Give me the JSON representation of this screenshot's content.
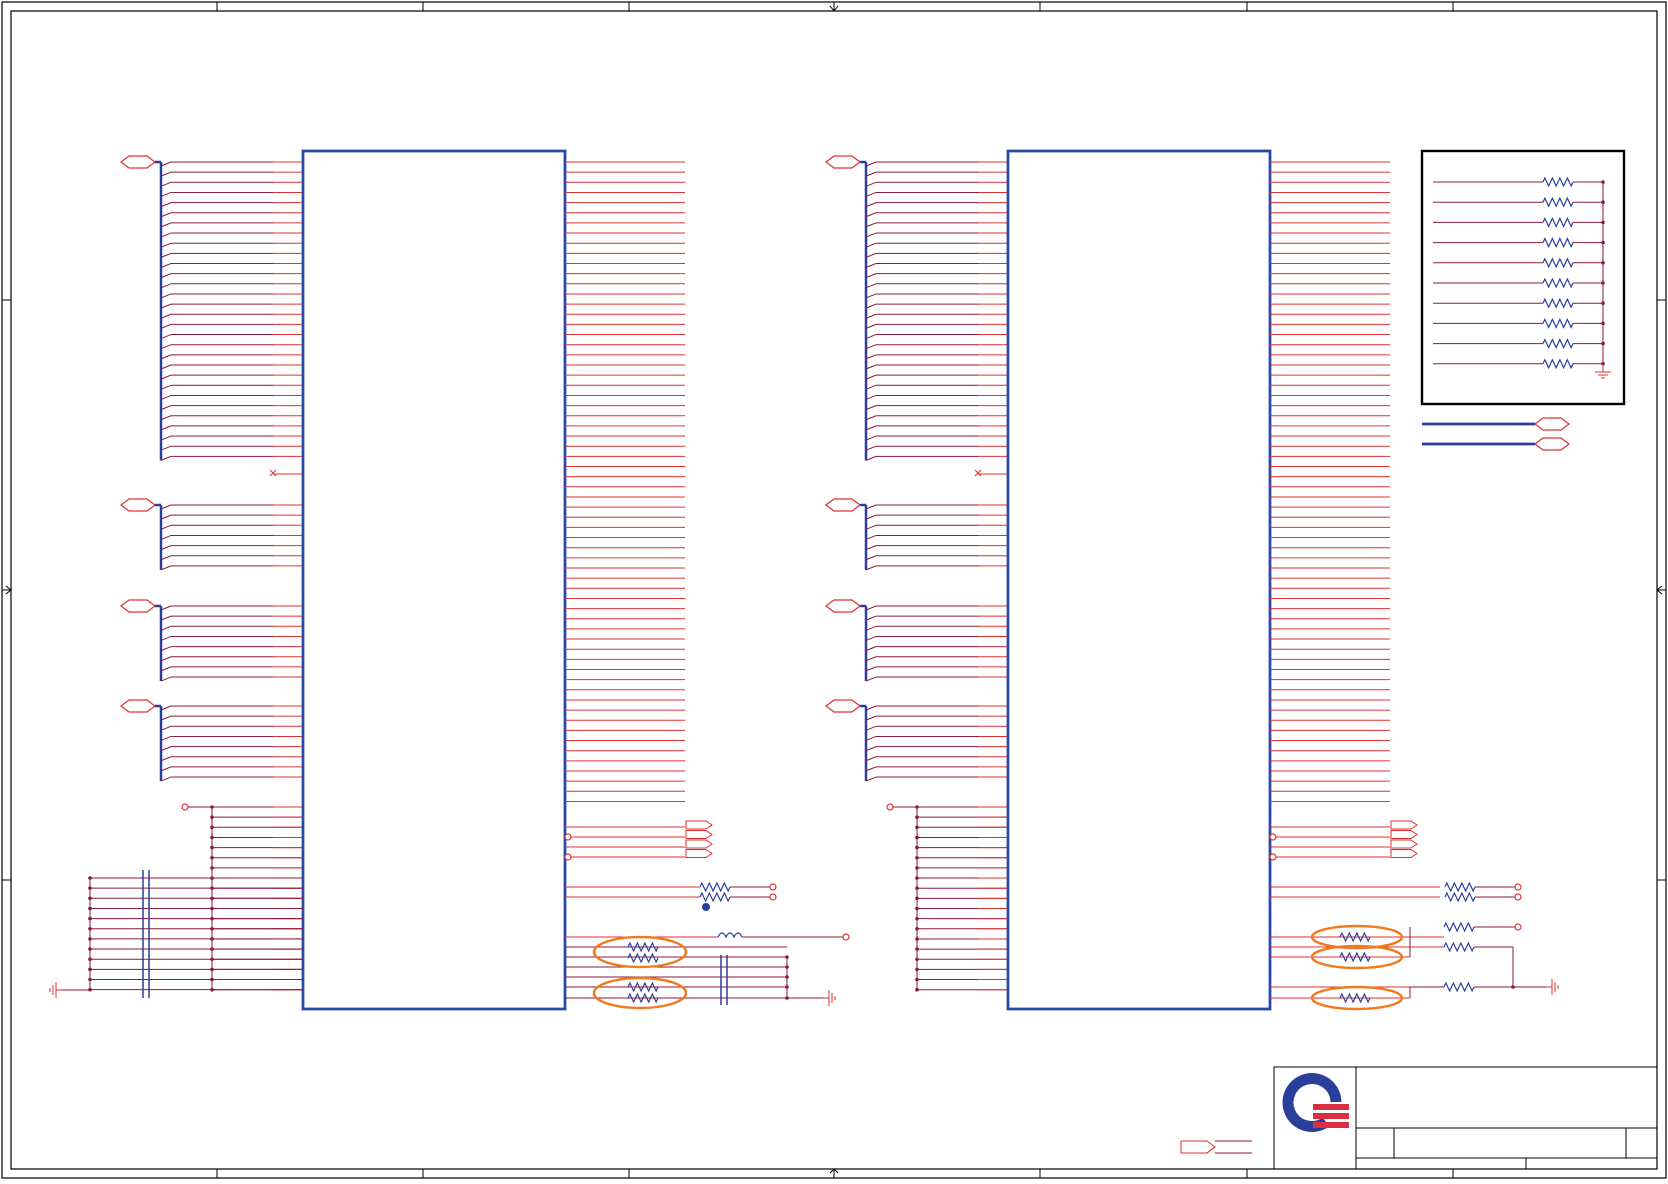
{
  "sheet": {
    "title_block": {
      "logo_name": "quanta-logo",
      "fields": []
    },
    "colors": {
      "wire": "#e03030",
      "wire_dark": "#8a1a3a",
      "bus": "#2a3f9c",
      "ic_border": "#2a4aa8",
      "highlight": "#f07a20",
      "frame": "#000000"
    },
    "symbols": {
      "icons": [
        "offpage-connector-icon",
        "resistor-icon",
        "ground-icon",
        "inductor-icon",
        "capacitor-icon",
        "junction-dot-icon",
        "no-connect-icon"
      ]
    }
  }
}
